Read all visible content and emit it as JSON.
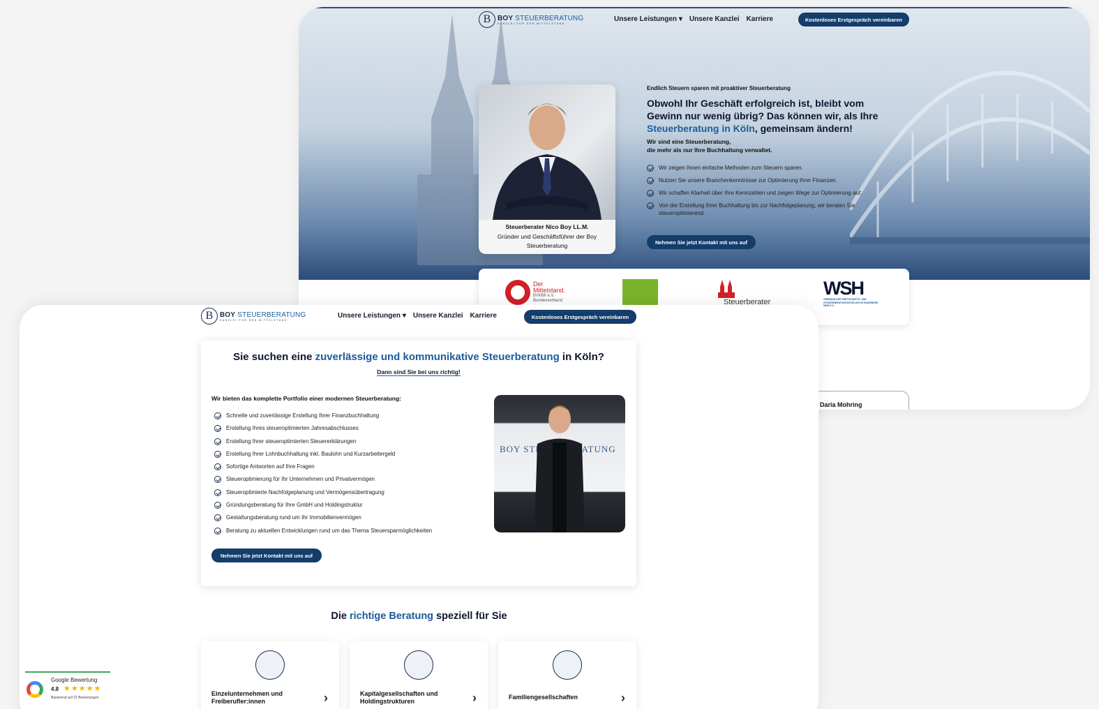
{
  "brand": {
    "name_bold": "BOY",
    "name_rest": "STEUERBERATUNG",
    "tagline": "KANZLEI FÜR DEN MITTELSTAND",
    "initial": "B"
  },
  "nav": {
    "items": [
      "Unsere Leistungen",
      "Unsere Kanzlei",
      "Karriere"
    ],
    "cta": "Kostenloses Erstgespräch vereinbaren"
  },
  "hero": {
    "eyebrow": "Endlich Steuern sparen mit proaktiver Steuerberatung",
    "headline_part1": "Obwohl Ihr Geschäft erfolgreich ist, bleibt vom Gewinn nur wenig übrig? Das können wir, als Ihre ",
    "headline_highlight": "Steuerberatung in Köln",
    "headline_part2": ", gemeinsam ändern!",
    "lead_line1": "Wir sind eine Steuerberatung,",
    "lead_line2": "die mehr als nur Ihre Buchhaltung verwaltet.",
    "bullets": [
      "Wir zeigen Ihnen einfache Methoden zum Steuern sparen.",
      "Nutzen Sie unsere Branchenkenntnisse zur Optimierung Ihrer Finanzen.",
      "Wir schaffen Klarheit über Ihre Kennzahlen und zeigen Wege zur Optimierung auf.",
      "Von der Erstellung Ihrer Buchhaltung bis zur Nachfolgeplanung, wir beraten Sie steueroptimierend."
    ],
    "cta": "Nehmen Sie jetzt Kontakt mit uns auf",
    "portrait_name": "Steuerberater Nico Boy LL.M.",
    "portrait_role": "Gründer und Geschäftsführer der Boy Steuerberatung"
  },
  "partners": {
    "mittelstand_line1": "Der",
    "mittelstand_line2": "Mittelstand.",
    "mittelstand_line3": "BVMW e.V.",
    "mittelstand_line4": "Bundesverband",
    "steuerberater": "Steuerberater",
    "wsh": "WSH",
    "wsh_sub": "VERBAND DER WIRTSCHAFTS- UND STEUERBERATUNGSSTELLEN IM HANDWERK NRW E.V."
  },
  "testimonial": {
    "name": "Daria Mohring"
  },
  "intro": {
    "heading_part1": "Sie suchen eine ",
    "heading_highlight": "zuverlässige und kommunikative Steuerberatung",
    "heading_part2": " in Köln?",
    "subheading": "Dann sind Sie bei uns richtig!",
    "list_title": "Wir bieten das komplette Portfolio einer modernen Steuerberatung:",
    "items": [
      "Schnelle und zuverlässige Erstellung Ihrer Finanzbuchhaltung",
      "Erstellung Ihres steueroptimierten Jahresabschlusses",
      "Erstellung Ihrer steueroptimierten Steuererklärungen",
      "Erstellung Ihrer Lohnbuchhaltung inkl. Baulohn und Kurzarbeitergeld",
      "Sofortige Antworten auf Ihre Fragen",
      "Steueroptimierung für Ihr Unternehmen und Privatvermögen",
      "Steueroptimierte Nachfolgeplanung und Vermögensübertragung",
      "Gründungsberatung für Ihre GmbH und Holdingstruktur",
      "Gestaltungsberatung rund um Ihr Immobilienvermögen",
      "Beratung zu aktuellen Entwicklungen rund um das Thema Steuersparmöglichkeiten"
    ],
    "cta": "Nehmen Sie jetzt Kontakt mit uns auf",
    "photo_sign": "BOY STEUERBERATUNG"
  },
  "services": {
    "heading_part1": "Die ",
    "heading_highlight": "richtige Beratung",
    "heading_part2": " speziell für Sie",
    "cards": [
      {
        "line1": "Einzelunternehmen und",
        "line2": "Freiberufler:innen"
      },
      {
        "line1": "Kapitalgesellschaften und",
        "line2": "Holdingstrukturen"
      },
      {
        "line1": "Familiengesellschaften",
        "line2": ""
      }
    ]
  },
  "google": {
    "title": "Google Bewertung",
    "rating": "4.8",
    "stars": "★★★★★",
    "basis": "Basierend auf 22 Bewertungen"
  },
  "colors": {
    "accent": "#1c5c9c",
    "navy": "#133d6b",
    "dark": "#0d1530"
  }
}
